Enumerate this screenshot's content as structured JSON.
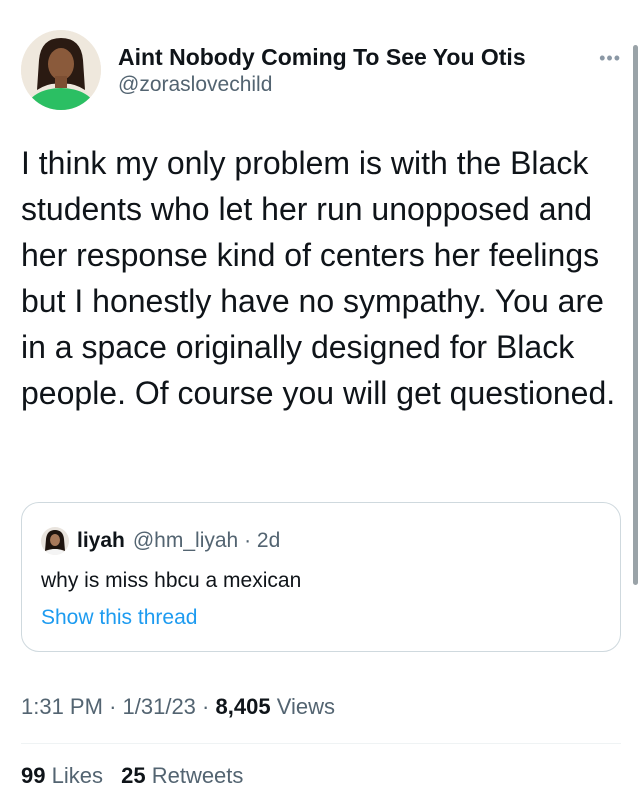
{
  "author": {
    "display_name": "Aint Nobody Coming To See You Otis",
    "handle": "@zoraslovechild"
  },
  "more_icon": "ellipsis-icon",
  "tweet": {
    "text": "I think my only problem is with the Black students who let her run unopposed and her response kind of centers her feelings but I honestly have no sympathy. You are in a space originally designed for Black people. Of course you will get questioned."
  },
  "quote": {
    "name": "liyah",
    "handle": "@hm_liyah",
    "separator": "·",
    "age": "2d",
    "text": "why is miss hbcu a mexican",
    "show_thread": "Show this thread"
  },
  "meta": {
    "time": "1:31 PM",
    "date": "1/31/23",
    "dot": "·",
    "views_count": "8,405",
    "views_label": "Views"
  },
  "stats": {
    "likes_count": "99",
    "likes_label": "Likes",
    "retweets_count": "25",
    "retweets_label": "Retweets"
  },
  "colors": {
    "link": "#1d9bf0",
    "secondary_text": "#536471",
    "border": "#cfd9de"
  }
}
